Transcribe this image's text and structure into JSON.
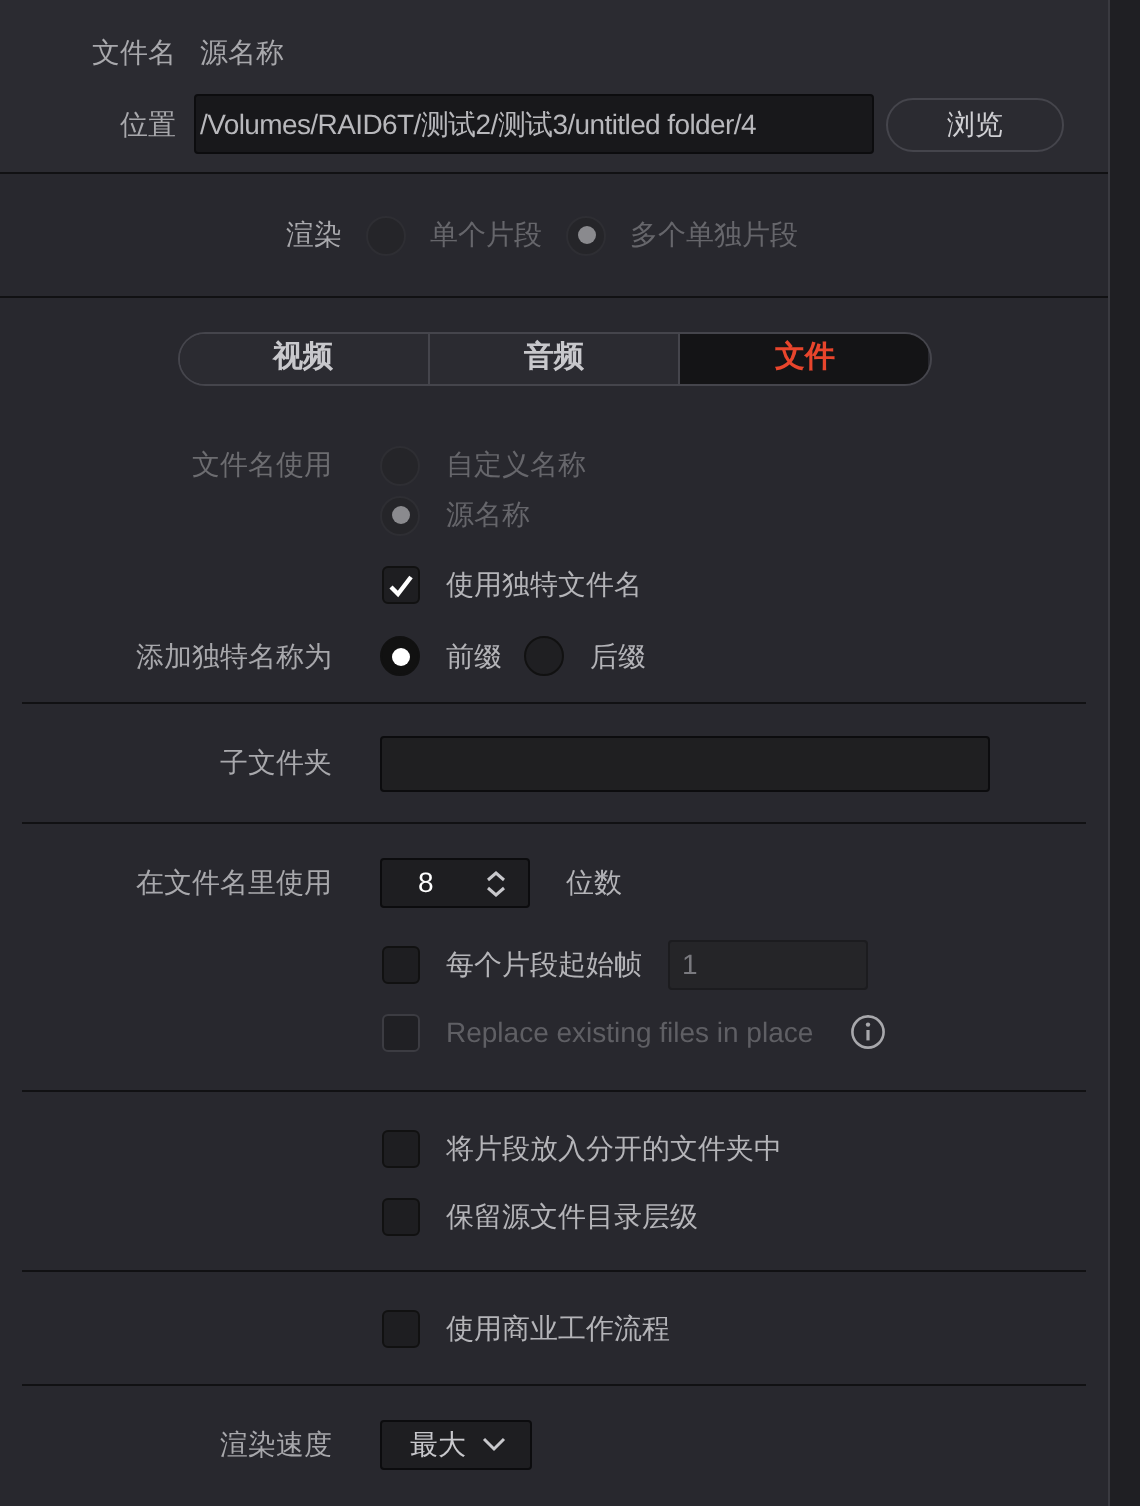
{
  "file_name": {
    "label": "文件名",
    "value": "源名称"
  },
  "location": {
    "label": "位置",
    "value": "/Volumes/RAID6T/测试2/测试3/untitled folder/4",
    "browse_button": "浏览"
  },
  "render": {
    "label": "渲染",
    "disabled": true,
    "options": [
      {
        "label": "单个片段",
        "selected": false
      },
      {
        "label": "多个单独片段",
        "selected": true
      }
    ]
  },
  "tabs": [
    {
      "label": "视频",
      "selected": false
    },
    {
      "label": "音频",
      "selected": false
    },
    {
      "label": "文件",
      "selected": true
    }
  ],
  "filename_use": {
    "label": "文件名使用",
    "disabled": true,
    "options": [
      {
        "label": "自定义名称",
        "selected": false
      },
      {
        "label": "源名称",
        "selected": true
      }
    ]
  },
  "unique_filename": {
    "label": "使用独特文件名",
    "checked": true
  },
  "add_unique_name_as": {
    "label": "添加独特名称为",
    "options": [
      {
        "label": "前缀",
        "selected": true
      },
      {
        "label": "后缀",
        "selected": false
      }
    ]
  },
  "subfolder": {
    "label": "子文件夹"
  },
  "digits": {
    "label": "在文件名里使用",
    "value": "8",
    "unit": "位数"
  },
  "start_frame": {
    "label": "每个片段起始帧",
    "checked": false,
    "value": "1",
    "field_disabled": true
  },
  "replace_existing": {
    "label": "Replace existing files in place",
    "checked": false,
    "disabled": true
  },
  "folder_options": [
    {
      "label": "将片段放入分开的文件夹中",
      "checked": false
    },
    {
      "label": "保留源文件目录层级",
      "checked": false
    }
  ],
  "commercial_workflow": {
    "label": "使用商业工作流程",
    "checked": false
  },
  "render_speed": {
    "label": "渲染速度",
    "value": "最大"
  }
}
